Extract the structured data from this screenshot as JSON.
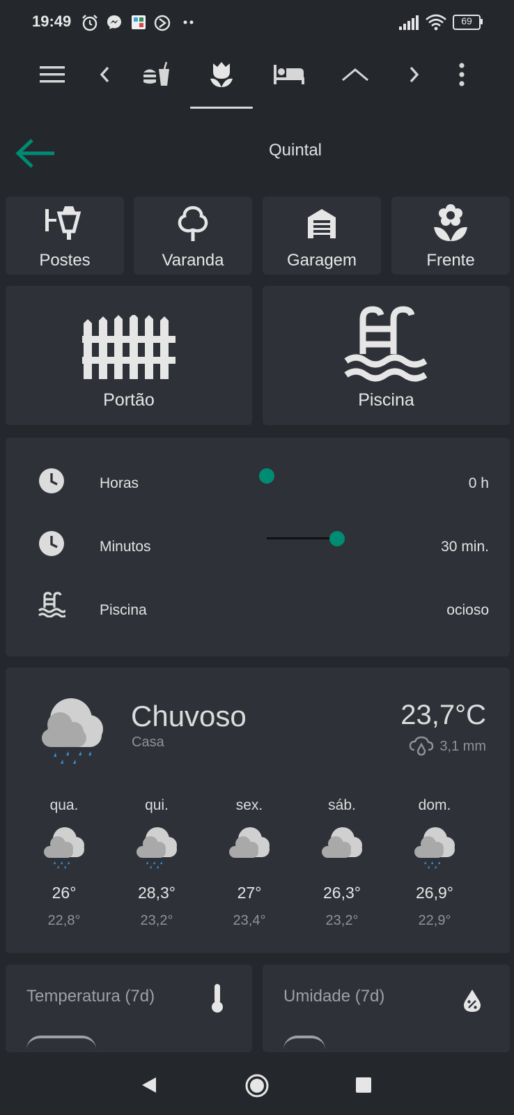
{
  "status_bar": {
    "time": "19:49",
    "left_icons": [
      "alarm-icon",
      "messenger-icon",
      "app-icon",
      "app-icon-2",
      "more-dots-icon"
    ],
    "right_icons": [
      "signal-icon",
      "wifi-icon",
      "battery-icon"
    ],
    "battery": "69"
  },
  "nav": {
    "tabs": [
      "kitchen-icon",
      "tulip-icon",
      "bed-icon",
      "roof-icon"
    ],
    "active_tab": 1
  },
  "header": {
    "title": "Quintal"
  },
  "tiles_small": [
    {
      "label": "Postes",
      "icon": "lamp-post-icon"
    },
    {
      "label": "Varanda",
      "icon": "tree-icon"
    },
    {
      "label": "Garagem",
      "icon": "garage-icon"
    },
    {
      "label": "Frente",
      "icon": "flower-icon"
    }
  ],
  "tiles_large": [
    {
      "label": "Portão",
      "icon": "gate-icon"
    },
    {
      "label": "Piscina",
      "icon": "pool-icon"
    }
  ],
  "entities": [
    {
      "label": "Horas",
      "value": "0 h",
      "icon": "clock-icon",
      "slider_fraction": 0.0
    },
    {
      "label": "Minutos",
      "value": "30 min.",
      "icon": "clock-icon",
      "slider_fraction": 1.0
    },
    {
      "label": "Piscina",
      "value": "ocioso",
      "icon": "pool-icon"
    }
  ],
  "weather": {
    "condition": "Chuvoso",
    "location": "Casa",
    "temperature": "23,7°C",
    "precipitation": "3,1 mm",
    "forecast": [
      {
        "day": "qua.",
        "high": "26°",
        "low": "22,8°",
        "rain": true
      },
      {
        "day": "qui.",
        "high": "28,3°",
        "low": "23,2°",
        "rain": true
      },
      {
        "day": "sex.",
        "high": "27°",
        "low": "23,4°",
        "rain": false
      },
      {
        "day": "sáb.",
        "high": "26,3°",
        "low": "23,2°",
        "rain": false
      },
      {
        "day": "dom.",
        "high": "26,9°",
        "low": "22,9°",
        "rain": true
      }
    ]
  },
  "sensors": [
    {
      "title": "Temperatura (7d)",
      "icon": "thermometer-icon"
    },
    {
      "title": "Umidade (7d)",
      "icon": "water-percent-icon"
    }
  ],
  "colors": {
    "accent": "#008c73",
    "background": "#24272c",
    "card": "#2e3238",
    "rain": "#3a8fd6"
  }
}
